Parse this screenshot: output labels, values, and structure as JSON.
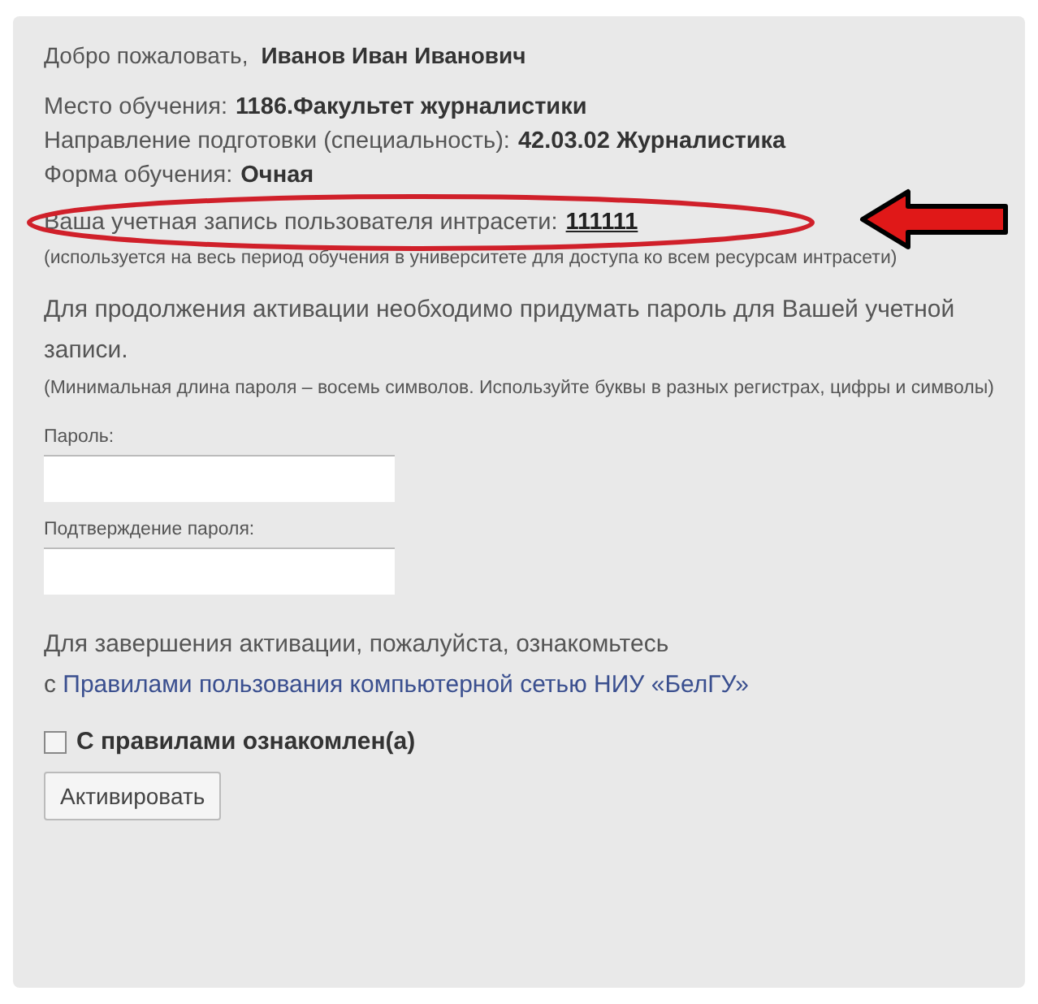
{
  "welcome": {
    "label": "Добро пожаловать,",
    "name": "Иванов Иван Иванович"
  },
  "info": [
    {
      "label": "Место обучения:",
      "value": "1186.Факультет журналистики"
    },
    {
      "label": "Направление подготовки (специальность):",
      "value": "42.03.02 Журналистика"
    },
    {
      "label": "Форма обучения:",
      "value": "Очная"
    }
  ],
  "account": {
    "label": "Ваша учетная запись пользователя интрасети:",
    "login": "111111",
    "hint": "(используется на весь период обучения в университете для доступа ко всем ресурсам интрасети)"
  },
  "activation": {
    "text": "Для продолжения активации необходимо придумать пароль для Вашей учетной записи.",
    "hint": "(Минимальная длина пароля – восемь символов. Используйте буквы в разных регистрах, цифры и символы)"
  },
  "fields": [
    {
      "label": "Пароль:"
    },
    {
      "label": "Подтверждение пароля:"
    }
  ],
  "rules": {
    "text": "Для завершения активации, пожалуйста, ознакомьтесь",
    "prefix": "с",
    "link": "Правилами пользования компьютерной сетью НИУ «БелГУ»"
  },
  "agree": {
    "label": "С правилами ознакомлен(а)",
    "checked": false
  },
  "button": "Активировать"
}
